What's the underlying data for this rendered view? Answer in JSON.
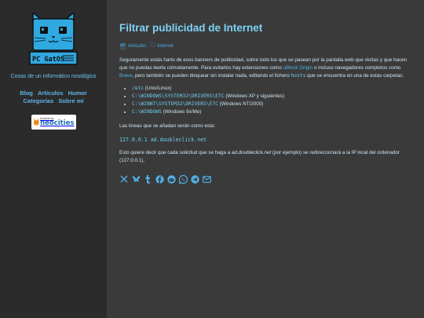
{
  "sidebar": {
    "logo_text": "PC GatOS",
    "tagline": "Cosas de un informático nostálgico",
    "nav": [
      "Blog",
      "Artículos",
      "Humor",
      "Categorías",
      "Sobre mí"
    ],
    "badge": {
      "small": "hosted by",
      "big": "neocities"
    }
  },
  "post": {
    "title": "Filtrar publicidad de Internet",
    "category": "Artículos",
    "tag": "Internet",
    "intro_1": "Seguramente estás harto de esos banners de publicidad, sobre todo los que se pasean por la pantalla web que visitas y que hacen que no puedas leerla cómodamente. Para evitarlos hay extensiones como ",
    "ublock": "uBlock Origin",
    "intro_2": " o incluso navegadores completos como ",
    "brave": "Brave",
    "intro_3": ", pero también se pueden bloquear sin instalar nada, editando el fichero ",
    "hosts": "hosts",
    "intro_4": " que se encuentra en una de estas carpetas:",
    "paths": [
      {
        "path": "/etc",
        "os": " (Unix/Linux)"
      },
      {
        "path": "C:\\WINDOWS\\SYSTEM32\\DRIVERS\\ETC",
        "os": " (Windows XP y siguientes)"
      },
      {
        "path": "C:\\WINNT\\SYSTEM32\\DRIVERS\\ETC",
        "os": " (Windows NT/2000)"
      },
      {
        "path": "C:\\WINDOWS",
        "os": " (Windows 9x/Me)"
      }
    ],
    "lines_intro": "Las líneas que se añadan serán como esta:",
    "code_line": "127.0.0.1 ad.doubleclick.net",
    "explain_1": "Esto quiere decir que cada solicitud que se haga a ",
    "explain_domain": "ad.doubleclick.net",
    "explain_2": " (por ejemplo) se redireccionará a la IP local del ordenador (127.0.0.1)."
  },
  "share_icons": [
    "x-icon",
    "bluesky-icon",
    "tumblr-icon",
    "facebook-icon",
    "reddit-icon",
    "whatsapp-icon",
    "telegram-icon",
    "email-icon"
  ],
  "colors": {
    "accent": "#4fb0e8",
    "title": "#7fd1f5",
    "sidebar_bg": "#2b2b2b",
    "main_bg": "#3a3a3a"
  }
}
